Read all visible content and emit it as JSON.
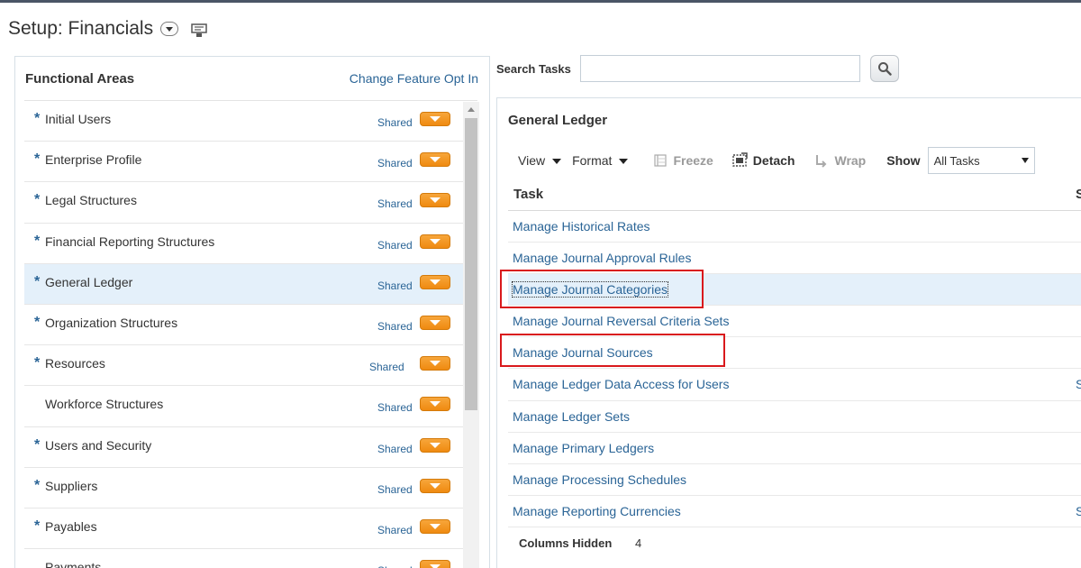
{
  "header": {
    "title": "Setup: Financials"
  },
  "left_panel": {
    "title": "Functional Areas",
    "change_link": "Change Feature Opt In",
    "areas": [
      {
        "name": "Initial Users",
        "required": "*",
        "shared": "Shared"
      },
      {
        "name": "Enterprise Profile",
        "required": "*",
        "shared": "Shared"
      },
      {
        "name": "Legal Structures",
        "required": "*",
        "shared": "Shared"
      },
      {
        "name": "Financial Reporting Structures",
        "required": "*",
        "shared": "Shared"
      },
      {
        "name": "General Ledger",
        "required": "*",
        "shared": "Shared"
      },
      {
        "name": "Organization Structures",
        "required": "*",
        "shared": "Shared"
      },
      {
        "name": "Resources",
        "required": "*",
        "shared": "Shared"
      },
      {
        "name": "Workforce Structures",
        "required": "",
        "shared": "Shared"
      },
      {
        "name": "Users and Security",
        "required": "*",
        "shared": "Shared"
      },
      {
        "name": "Suppliers",
        "required": "*",
        "shared": "Shared"
      },
      {
        "name": "Payables",
        "required": "*",
        "shared": "Shared"
      },
      {
        "name": "Payments",
        "required": "",
        "shared": "Shared"
      }
    ],
    "selected_index": 4
  },
  "search": {
    "label": "Search Tasks",
    "value": "",
    "placeholder": ""
  },
  "right_panel": {
    "title": "General Ledger",
    "toolbar": {
      "view": "View",
      "format": "Format",
      "freeze": "Freeze",
      "detach": "Detach",
      "wrap": "Wrap",
      "show_label": "Show",
      "show_value": "All Tasks"
    },
    "table": {
      "col_task": "Task",
      "col_second_trunc": "S",
      "tasks": [
        {
          "name": "Manage Historical Rates",
          "trunc": ""
        },
        {
          "name": "Manage Journal Approval Rules",
          "trunc": ""
        },
        {
          "name": "Manage Journal Categories",
          "trunc": ""
        },
        {
          "name": "Manage Journal Reversal Criteria Sets",
          "trunc": ""
        },
        {
          "name": "Manage Journal Sources",
          "trunc": ""
        },
        {
          "name": "Manage Ledger Data Access for Users",
          "trunc": "S"
        },
        {
          "name": "Manage Ledger Sets",
          "trunc": ""
        },
        {
          "name": "Manage Primary Ledgers",
          "trunc": ""
        },
        {
          "name": "Manage Processing Schedules",
          "trunc": ""
        },
        {
          "name": "Manage Reporting Currencies",
          "trunc": "S"
        }
      ],
      "selected_index": 2,
      "columns_hidden_label": "Columns Hidden",
      "columns_hidden_value": "4"
    }
  },
  "colors": {
    "link": "#2a6496",
    "selected_row": "#e4f0fa",
    "orange_button": "#f0921c",
    "highlight_box": "#d9191c"
  }
}
